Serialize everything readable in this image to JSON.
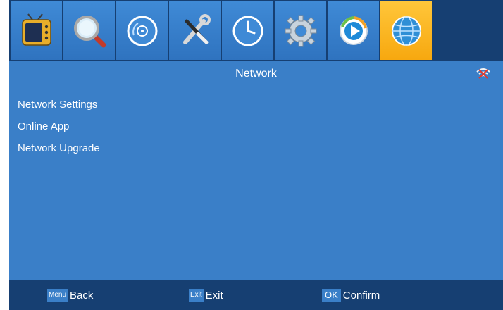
{
  "menu_bar": {
    "tiles": [
      {
        "icon": "tv-icon",
        "active": false
      },
      {
        "icon": "search-icon",
        "active": false
      },
      {
        "icon": "disc-icon",
        "active": false
      },
      {
        "icon": "tools-icon",
        "active": false
      },
      {
        "icon": "clock-icon",
        "active": false
      },
      {
        "icon": "gear-icon",
        "active": false
      },
      {
        "icon": "media-play-icon",
        "active": false
      },
      {
        "icon": "globe-icon",
        "active": true
      }
    ]
  },
  "header": {
    "title": "Network",
    "status_icon": "wifi-disconnected-icon"
  },
  "menu": {
    "items": [
      {
        "label": "Network Settings"
      },
      {
        "label": "Online App"
      },
      {
        "label": "Network Upgrade"
      }
    ]
  },
  "hints": {
    "back": {
      "key": "Menu",
      "label": "Back"
    },
    "exit": {
      "key": "Exit",
      "label": "Exit"
    },
    "confirm": {
      "key": "OK",
      "label": "Confirm"
    }
  },
  "colors": {
    "background": "#3a7fc8",
    "bar": "#163f72",
    "active_tile": "#f7a80f"
  }
}
